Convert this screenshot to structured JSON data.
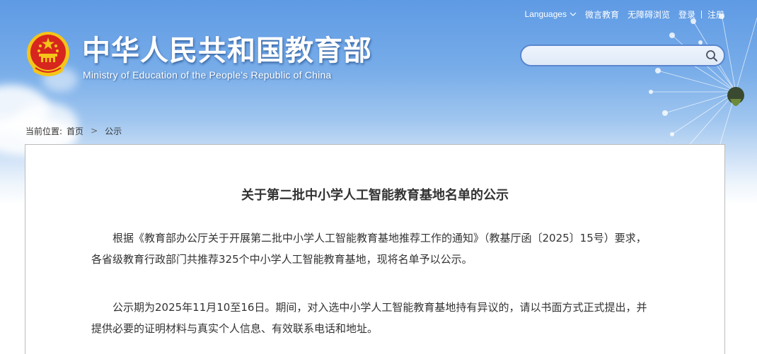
{
  "header": {
    "title_cn": "中华人民共和国教育部",
    "title_en": "Ministry of Education of the People's Republic of China",
    "top_links": {
      "languages": "Languages",
      "weibo": "微言教育",
      "accessibility": "无障碍浏览",
      "login": "登录",
      "register": "注册"
    },
    "search": {
      "placeholder": "",
      "value": ""
    }
  },
  "breadcrumb": {
    "prefix": "当前位置:",
    "home": "首页",
    "separator": ">",
    "current": "公示"
  },
  "article": {
    "title": "关于第二批中小学人工智能教育基地名单的公示",
    "paragraphs": [
      "根据《教育部办公厅关于开展第二批中小学人工智能教育基地推荐工作的通知》（教基厅函〔2025〕15号）要求，各省级教育行政部门共推荐325个中小学人工智能教育基地，现将名单予以公示。",
      "公示期为2025年11月10至16日。期间，对入选中小学人工智能教育基地持有异议的，请以书面方式正式提出，并提供必要的证明材料与真实个人信息、有效联系电话和地址。"
    ]
  },
  "colors": {
    "sky_top": "#5e9ae4",
    "search_border": "#5b86cf",
    "text": "#333333",
    "box_border": "#bcbcbc",
    "emblem_red": "#d7261e",
    "emblem_gold": "#f5c518"
  },
  "icons": [
    "national-emblem-icon",
    "chevron-down-icon",
    "search-icon",
    "dandelion-decoration"
  ]
}
